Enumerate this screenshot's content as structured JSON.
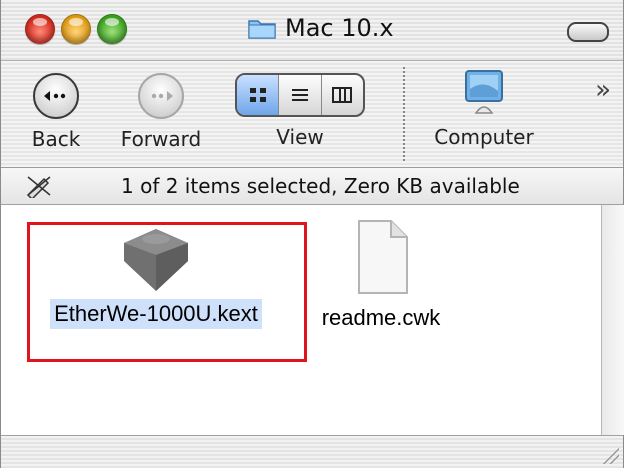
{
  "window": {
    "title": "Mac 10.x"
  },
  "toolbar": {
    "back_label": "Back",
    "forward_label": "Forward",
    "view_label": "View",
    "computer_label": "Computer",
    "view_modes": [
      "icon-view-icon",
      "list-view-icon",
      "column-view-icon"
    ],
    "active_view": "icon-view-icon",
    "overflow_symbol": "»"
  },
  "status": {
    "text": "1 of 2 items selected, Zero KB available"
  },
  "files": [
    {
      "name": "EtherWe-1000U.kext",
      "icon": "kext-bundle-icon",
      "selected": true
    },
    {
      "name": "readme.cwk",
      "icon": "document-icon",
      "selected": false
    }
  ],
  "colors": {
    "selection": "#cfe0fb",
    "highlight_box": "#e0141c"
  }
}
